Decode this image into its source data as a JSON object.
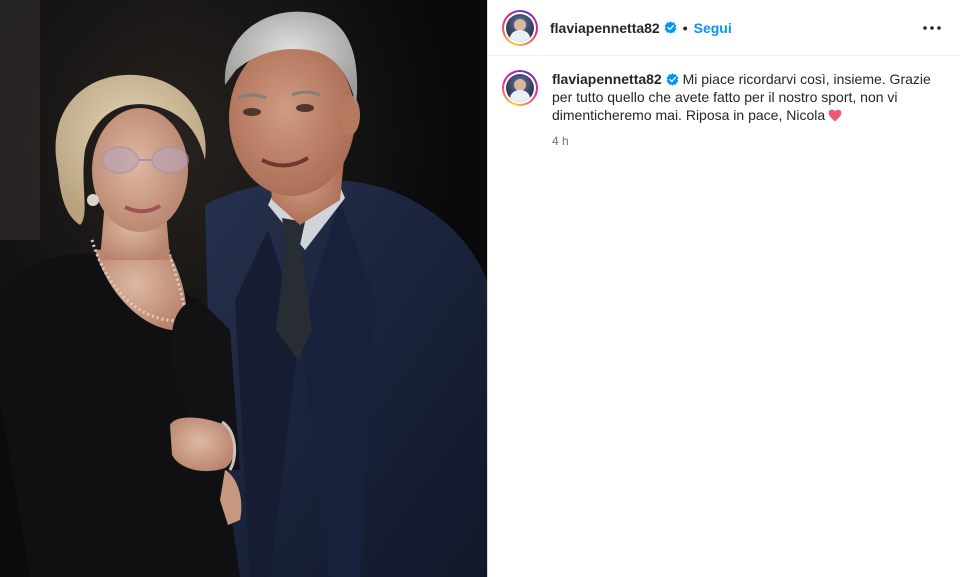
{
  "post": {
    "username": "flaviapennetta82",
    "follow_label": "Segui",
    "separator": "•",
    "caption": "Mi piace ricordarvi così, insieme. Grazie per tutto quello che avete fatto per il nostro sport, non vi dimenticheremo mai. Riposa in pace, Nicola",
    "timestamp": "4 h"
  },
  "icons": {
    "verified": "verified-badge-icon",
    "more": "more-options-icon",
    "heart": "heart-emoji-icon"
  },
  "colors": {
    "follow": "#0095f6",
    "verified": "#0095f6",
    "heart": "#f0577a",
    "divider": "#dbdbdb"
  }
}
